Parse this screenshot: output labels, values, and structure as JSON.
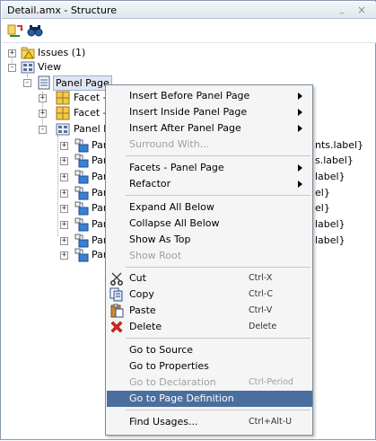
{
  "window": {
    "title": "Detail.amx - Structure",
    "minimize_glyph": "_",
    "close_glyph": "×"
  },
  "toolbar": {
    "icons": [
      "synchronize-icon",
      "find-icon"
    ]
  },
  "tree": {
    "issues_label": "Issues (1)",
    "view_label": "View",
    "panel_page_label": "Panel Page",
    "facet1_label": "Facet -",
    "facet2_label": "Facet -",
    "panel_form_label": "Panel F",
    "children": [
      {
        "label": "Pan",
        "suffix": "nts.label}"
      },
      {
        "label": "Pan",
        "suffix": "s.label}"
      },
      {
        "label": "Pan",
        "suffix": "label}"
      },
      {
        "label": "Pan",
        "suffix": "el}"
      },
      {
        "label": "Pan",
        "suffix": "el}"
      },
      {
        "label": "Pan",
        "suffix": "label}"
      },
      {
        "label": "Pan",
        "suffix": "label}"
      },
      {
        "label": "Pan",
        "suffix": ""
      }
    ]
  },
  "context_menu": {
    "insert_before": "Insert Before Panel Page",
    "insert_inside": "Insert Inside Panel Page",
    "insert_after": "Insert After Panel Page",
    "surround_with": "Surround With...",
    "facets": "Facets - Panel Page",
    "refactor": "Refactor",
    "expand_all": "Expand All Below",
    "collapse_all": "Collapse All Below",
    "show_as_top": "Show As Top",
    "show_root": "Show Root",
    "cut": "Cut",
    "cut_shortcut": "Ctrl-X",
    "copy": "Copy",
    "copy_shortcut": "Ctrl-C",
    "paste": "Paste",
    "paste_shortcut": "Ctrl-V",
    "delete": "Delete",
    "delete_shortcut": "Delete",
    "go_to_source": "Go to Source",
    "go_to_properties": "Go to Properties",
    "go_to_declaration": "Go to Declaration",
    "go_to_declaration_shortcut": "Ctrl-Period",
    "go_to_page_definition": "Go to Page Definition",
    "find_usages": "Find Usages...",
    "find_usages_shortcut": "Ctrl+Alt-U"
  },
  "colors": {
    "highlight": "#4a6f9e",
    "menu_bg": "#f5f5f5",
    "disabled_text": "#a0a0a0"
  }
}
